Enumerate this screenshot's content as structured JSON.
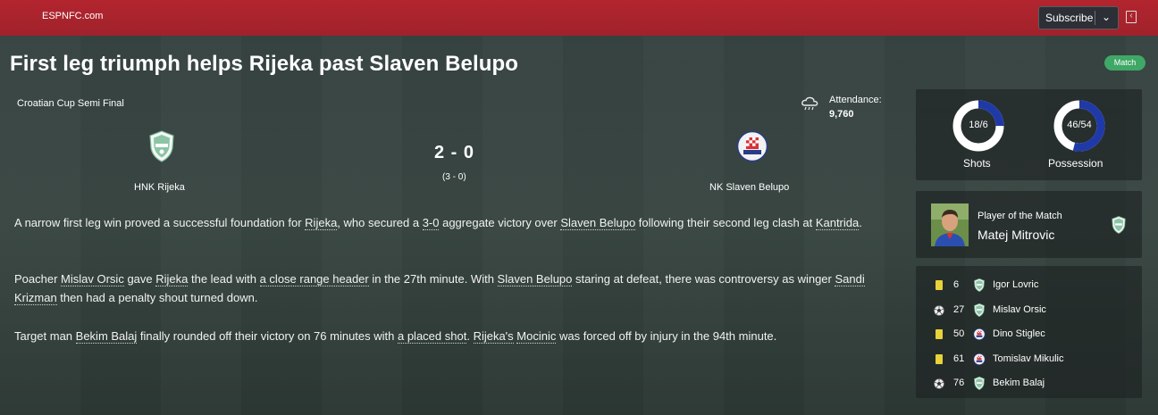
{
  "header": {
    "brand": "ESPNFC.com",
    "subscribe_label": "Subscribe"
  },
  "article": {
    "headline": "First leg triumph helps Rijeka past Slaven Belupo",
    "badge": "Match",
    "paragraphs": [
      [
        "A narrow first leg win proved a successful foundation for ",
        "Rijeka",
        ", who secured a ",
        "3-0",
        " aggregate victory over ",
        "Slaven Belupo",
        " following their second leg clash at ",
        "Kantrida",
        "."
      ],
      [
        "Poacher ",
        "Mislav Orsic",
        " gave ",
        "Rijeka",
        " the lead with ",
        "a close range header",
        " in the 27th minute. With ",
        "Slaven Belupo",
        " staring at defeat, there was controversy as winger ",
        "Sandi Krizman",
        " then had a penalty shout turned down."
      ],
      [
        "Target man ",
        "Bekim Balaj",
        " finally rounded off their victory on 76 minutes with ",
        "a placed shot",
        ". ",
        "Rijeka's",
        " ",
        "Mocinic",
        " was forced off by injury in the 94th minute."
      ]
    ]
  },
  "match": {
    "competition": "Croatian Cup Semi Final",
    "attendance_label": "Attendance:",
    "attendance_value": "9,760",
    "home_team": "HNK Rijeka",
    "away_team": "NK Slaven Belupo",
    "score": "2 - 0",
    "aggregate": "(3 - 0)",
    "weather_icon": "cloud-rain-icon"
  },
  "stats": {
    "shots_text": "18/6",
    "shots_home": 18,
    "shots_away": 6,
    "shots_label": "Shots",
    "possession_text": "46/54",
    "possession_home": 46,
    "possession_away": 54,
    "possession_label": "Possession",
    "home_color": "#ffffff",
    "away_color": "#1f3aa8"
  },
  "potm": {
    "title": "Player of the Match",
    "name": "Matej Mitrovic"
  },
  "events": [
    {
      "type": "yellow-card",
      "minute": "6",
      "team": "home",
      "player": "Igor Lovric"
    },
    {
      "type": "goal",
      "minute": "27",
      "team": "home",
      "player": "Mislav Orsic"
    },
    {
      "type": "yellow-card",
      "minute": "50",
      "team": "away",
      "player": "Dino Stiglec"
    },
    {
      "type": "yellow-card",
      "minute": "61",
      "team": "away",
      "player": "Tomislav Mikulic"
    },
    {
      "type": "goal",
      "minute": "76",
      "team": "home",
      "player": "Bekim Balaj"
    }
  ]
}
